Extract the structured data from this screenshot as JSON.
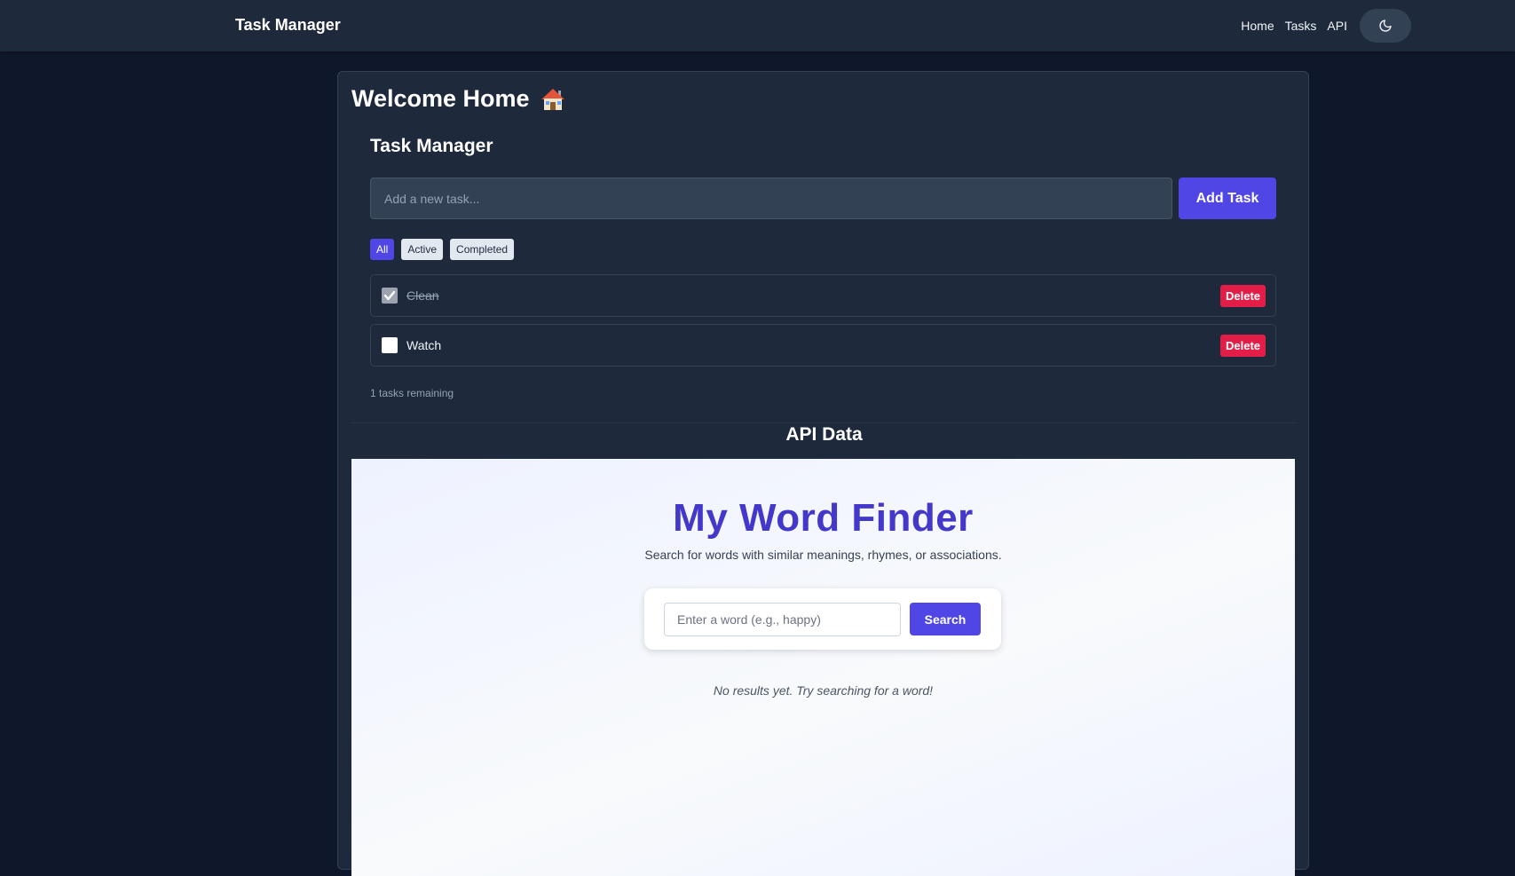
{
  "navbar": {
    "brand": "Task Manager",
    "links": [
      "Home",
      "Tasks",
      "API"
    ],
    "theme_icon": "moon-icon"
  },
  "main": {
    "welcome": "Welcome Home",
    "welcome_icon": "house-icon",
    "task_manager_title": "Task Manager",
    "task_input_placeholder": "Add a new task...",
    "add_button": "Add Task",
    "filters": [
      {
        "label": "All",
        "active": true
      },
      {
        "label": "Active",
        "active": false
      },
      {
        "label": "Completed",
        "active": false
      }
    ],
    "tasks": [
      {
        "text": "Clean",
        "completed": true,
        "delete_label": "Delete"
      },
      {
        "text": "Watch",
        "completed": false,
        "delete_label": "Delete"
      }
    ],
    "remaining": "1 tasks remaining",
    "api_title": "API Data"
  },
  "word_finder": {
    "title": "My Word Finder",
    "subtitle": "Search for words with similar meanings, rhymes, or associations.",
    "input_placeholder": "Enter a word (e.g., happy)",
    "search_button": "Search",
    "no_results": "No results yet. Try searching for a word!"
  },
  "colors": {
    "accent": "#4f46e5",
    "danger": "#e11d48",
    "background": "#0f172a",
    "surface": "#1e293b",
    "word_finder_title": "#4338ca"
  }
}
